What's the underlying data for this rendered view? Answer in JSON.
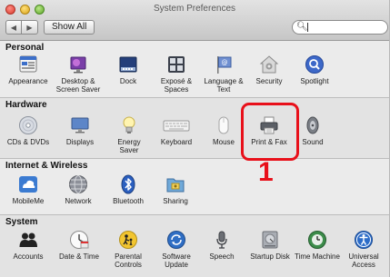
{
  "window": {
    "title": "System Preferences"
  },
  "toolbar": {
    "back": "◀",
    "forward": "▶",
    "show_all": "Show All",
    "search_value": ""
  },
  "sections": {
    "personal": {
      "title": "Personal",
      "items": [
        {
          "label": "Appearance"
        },
        {
          "label": "Desktop &\nScreen Saver"
        },
        {
          "label": "Dock"
        },
        {
          "label": "Exposé &\nSpaces"
        },
        {
          "label": "Language &\nText"
        },
        {
          "label": "Security"
        },
        {
          "label": "Spotlight"
        }
      ]
    },
    "hardware": {
      "title": "Hardware",
      "items": [
        {
          "label": "CDs & DVDs"
        },
        {
          "label": "Displays"
        },
        {
          "label": "Energy\nSaver"
        },
        {
          "label": "Keyboard"
        },
        {
          "label": "Mouse"
        },
        {
          "label": "Print & Fax"
        },
        {
          "label": "Sound"
        }
      ]
    },
    "internet": {
      "title": "Internet & Wireless",
      "items": [
        {
          "label": "MobileMe"
        },
        {
          "label": "Network"
        },
        {
          "label": "Bluetooth"
        },
        {
          "label": "Sharing"
        }
      ]
    },
    "system": {
      "title": "System",
      "items": [
        {
          "label": "Accounts"
        },
        {
          "label": "Date & Time"
        },
        {
          "label": "Parental\nControls"
        },
        {
          "label": "Software\nUpdate"
        },
        {
          "label": "Speech"
        },
        {
          "label": "Startup Disk"
        },
        {
          "label": "Time Machine"
        },
        {
          "label": "Universal\nAccess"
        }
      ]
    }
  },
  "annotation": {
    "number": "1",
    "color": "#e8101a"
  }
}
